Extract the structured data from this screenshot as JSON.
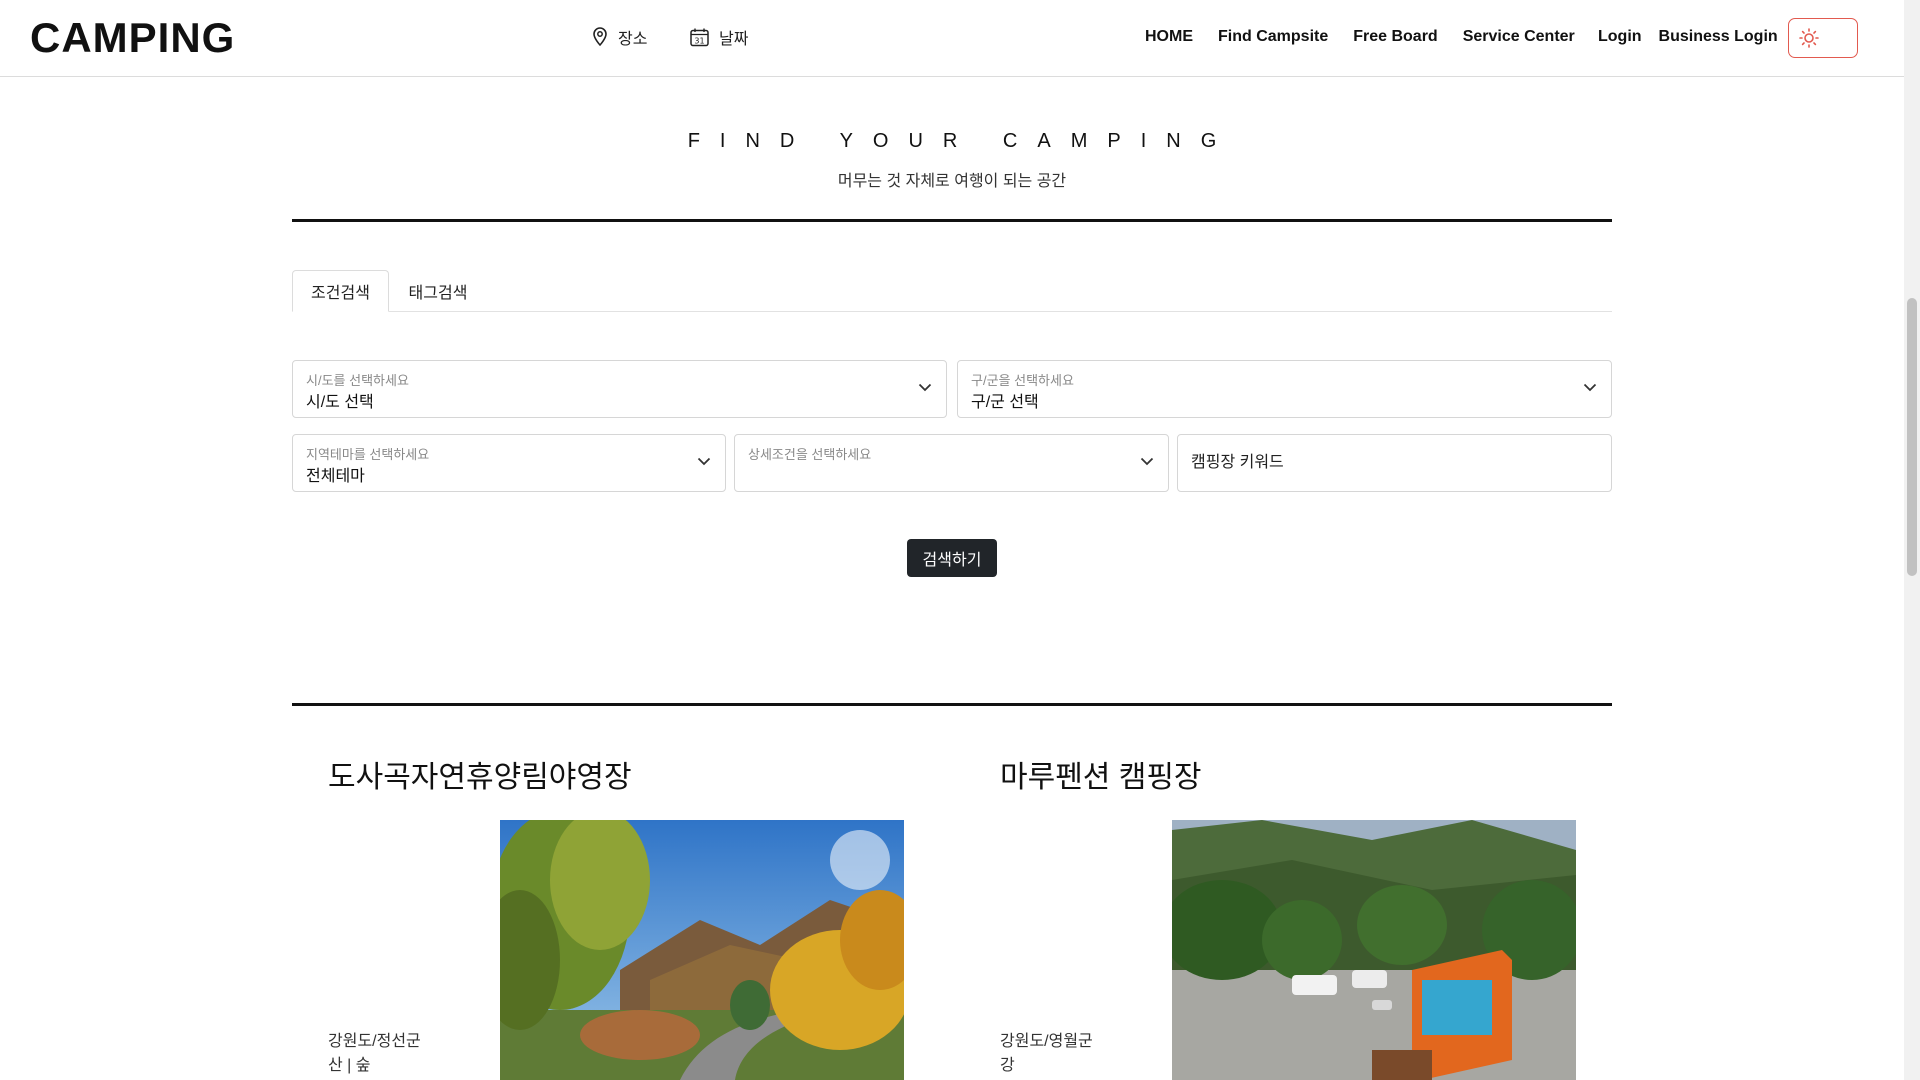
{
  "header": {
    "logo": "CAMPING",
    "quick_place": "장소",
    "quick_date": "날짜",
    "calendar_day": "31",
    "nav": [
      "HOME",
      "Find Campsite",
      "Free Board",
      "Service Center"
    ],
    "auth": [
      "Login",
      "Business Login"
    ],
    "theme_icon": "sun-icon"
  },
  "hero": {
    "title": "FIND YOUR CAMPING",
    "subtitle": "머무는 것 자체로 여행이 되는 공간"
  },
  "search": {
    "tabs": [
      "조건검색",
      "태그검색"
    ],
    "active_tab": 0,
    "sido": {
      "label": "시/도를 선택하세요",
      "value": "시/도 선택"
    },
    "gugun": {
      "label": "구/군을 선택하세요",
      "value": "구/군 선택"
    },
    "theme": {
      "label": "지역테마를 선택하세요",
      "value": "전체테마"
    },
    "detail": {
      "label": "상세조건을 선택하세요",
      "value": ""
    },
    "keyword_placeholder": "캠핑장 키워드",
    "submit_label": "검색하기"
  },
  "results": [
    {
      "name": "도사곡자연휴양림야영장",
      "region": "강원도/정선군",
      "tags": "산 | 숲",
      "photo": "autumn forest road"
    },
    {
      "name": "마루펜션 캠핑장",
      "region": "강원도/영월군",
      "tags": "강",
      "photo": "campsite with caravans"
    }
  ],
  "colors": {
    "accent_border": "#e25a4f",
    "button_dark": "#212529",
    "rule": "#111111"
  }
}
